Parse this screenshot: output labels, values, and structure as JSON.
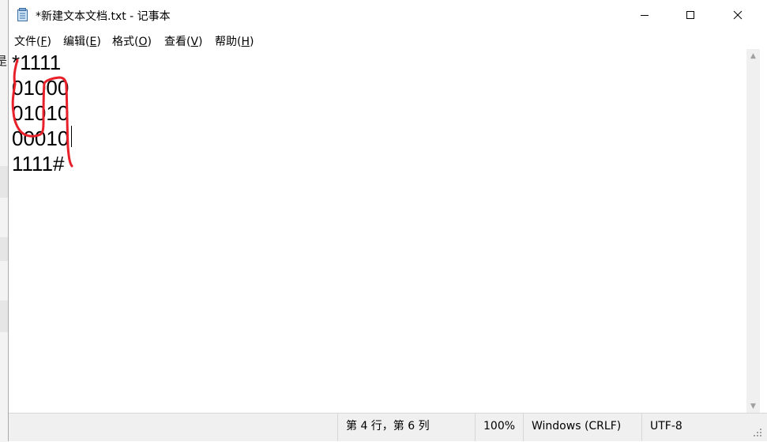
{
  "window": {
    "title": "*新建文本文档.txt - 记事本"
  },
  "menu": [
    {
      "label": "文件(",
      "key": "F",
      "end": ")"
    },
    {
      "label": "编辑(",
      "key": "E",
      "end": ")"
    },
    {
      "label": "格式(",
      "key": "O",
      "end": ")"
    },
    {
      "label": "查看(",
      "key": "V",
      "end": ")"
    },
    {
      "label": "帮助(",
      "key": "H",
      "end": ")"
    }
  ],
  "editor": {
    "lines": [
      "*1111",
      "01000",
      "01010",
      "00010",
      "1111#"
    ]
  },
  "background_glyph": "是",
  "status": {
    "position": "第 4 行，第 6 列",
    "zoom": "100%",
    "line_ending": "Windows (CRLF)",
    "encoding": "UTF-8"
  },
  "colors": {
    "annotation_stroke": "#e8202a",
    "statusbar_bg": "#f0f0f0"
  },
  "icons": [
    "notepad-icon",
    "minimize-icon",
    "maximize-icon",
    "close-icon",
    "scroll-up-icon",
    "scroll-down-icon",
    "resize-grip-icon"
  ]
}
